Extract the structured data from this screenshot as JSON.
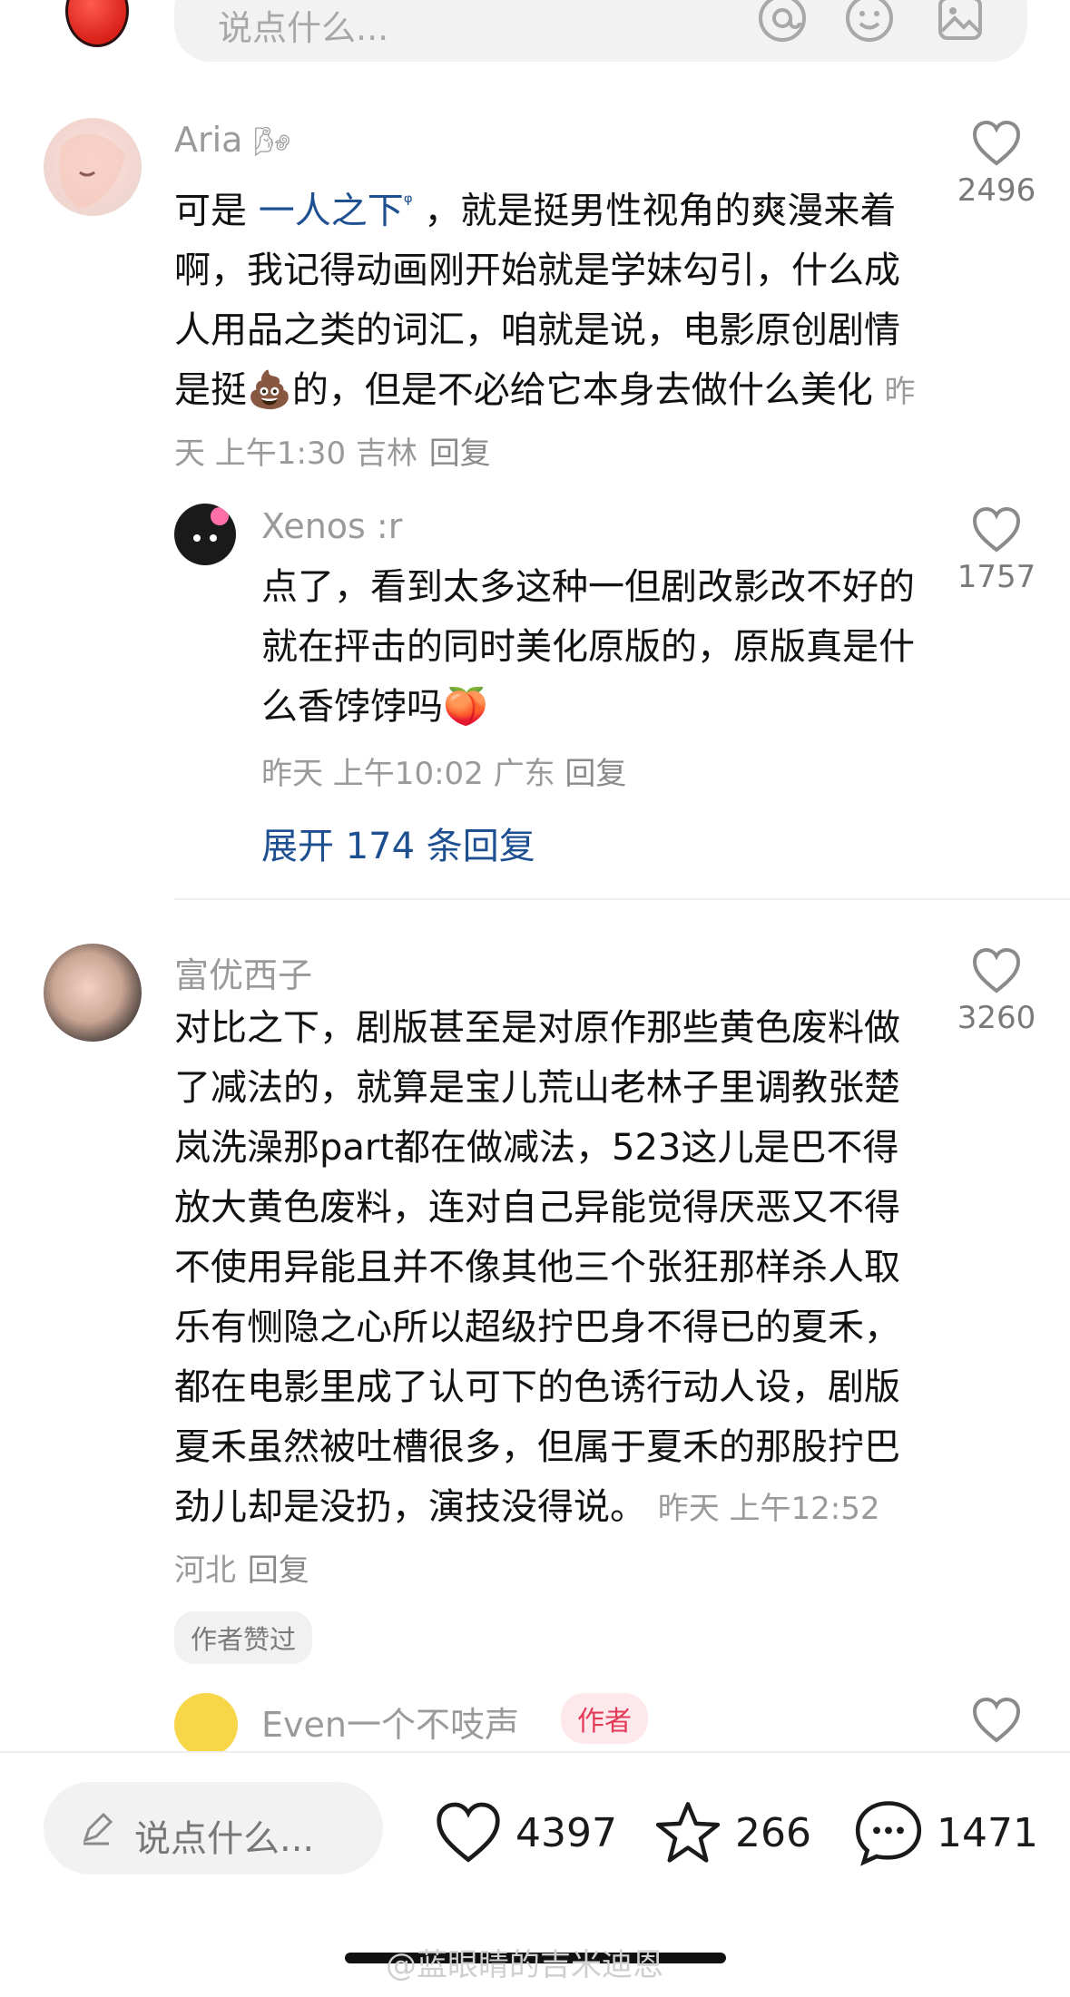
{
  "top_input": {
    "placeholder": "说点什么..."
  },
  "comments": [
    {
      "user": "Aria",
      "text_before": "可是 ",
      "mention": "一人之下",
      "text_after": " ，就是挺男性视角的爽漫来着啊，我记得动画刚开始就是学妹勾引，什么成人用品之类的词汇，咱就是说，电影原创剧情是挺",
      "emoji": "💩",
      "text_tail": "的，但是不必给它本身去做什么美化",
      "meta": "昨天 上午1:30 吉林",
      "reply": "回复",
      "likes": "2496"
    },
    {
      "user": "Xenos :r",
      "text": "点了，看到太多这种一但剧改影改不好的就在抨击的同时美化原版的，原版真是什么香饽饽吗",
      "emoji": "🍑",
      "meta": "昨天 上午10:02 广东",
      "reply": "回复",
      "likes": "1757",
      "expand": "展开 174 条回复"
    },
    {
      "user": "富优西子",
      "text": "对比之下，剧版甚至是对原作那些黄色废料做了减法的，就算是宝儿荒山老林子里调教张楚岚洗澡那part都在做减法，523这儿是巴不得放大黄色废料，连对自己异能觉得厌恶又不得不使用异能且并不像其他三个张狂那样杀人取乐有恻隐之心所以超级拧巴身不得已的夏禾，都在电影里成了认可下的色诱行动人设，剧版夏禾虽然被吐槽很多，但属于夏禾的那股拧巴劲儿却是没扔，演技没得说。",
      "meta": "昨天 上午12:52 河北",
      "reply": "回复",
      "likes": "3260",
      "badge": "作者赞过"
    },
    {
      "user": "Even一个不吱声",
      "author_tag": "作者"
    }
  ],
  "bottom_bar": {
    "placeholder": "说点什么...",
    "likes": "4397",
    "favorites": "266",
    "comments": "1471"
  },
  "watermark": "@蓝眼睛的吉米迪恩",
  "colors": {
    "link": "#1d4f91",
    "author_tag": "#e23b5a"
  }
}
